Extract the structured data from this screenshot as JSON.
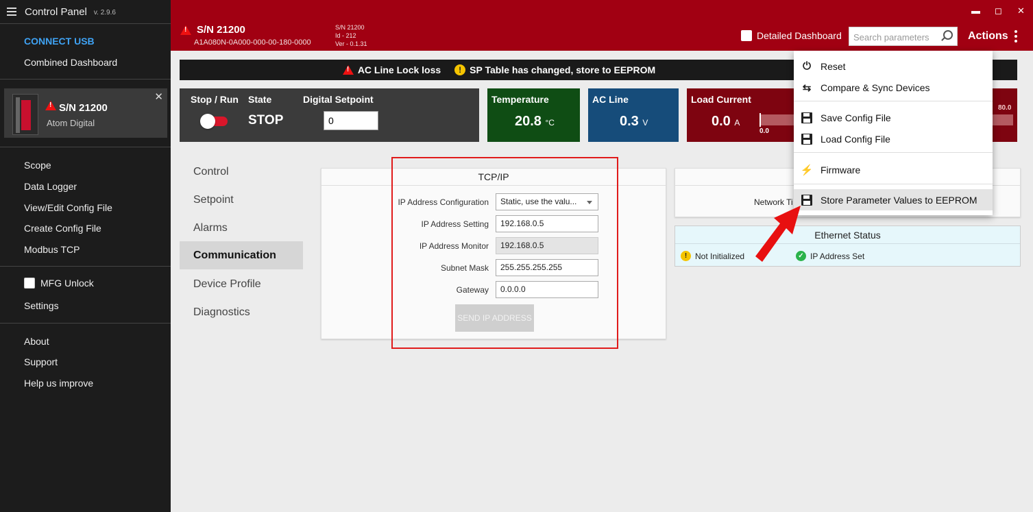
{
  "app": {
    "title": "Control Panel",
    "version": "v. 2.9.6"
  },
  "sidebar": {
    "connect_usb": "CONNECT USB",
    "combined_dashboard": "Combined Dashboard",
    "device": {
      "sn": "S/N 21200",
      "name": "Atom Digital",
      "close": "✕"
    },
    "tools": [
      "Scope",
      "Data Logger",
      "View/Edit Config File",
      "Create Config File",
      "Modbus TCP"
    ],
    "mfg_unlock": "MFG Unlock",
    "settings": "Settings",
    "about": "About",
    "support": "Support",
    "help": "Help us improve"
  },
  "header": {
    "sn": "S/N 21200",
    "model": "A1A080N-0A000-000-00-180-0000",
    "info": [
      "S/N 21200",
      "Id - 212",
      "Ver - 0.1.31"
    ],
    "detailed_dashboard": "Detailed Dashboard",
    "search_placeholder": "Search parameters",
    "actions": "Actions",
    "window": {
      "minimize": "▬",
      "maximize": "◻",
      "close": "✕"
    }
  },
  "alerts": {
    "alert1": "AC Line Lock loss",
    "alert2": "SP Table has changed, store to EEPROM"
  },
  "control": {
    "stop_run": "Stop / Run",
    "state_label": "State",
    "state_value": "STOP",
    "setpoint_label": "Digital Setpoint",
    "setpoint_value": "0"
  },
  "tiles": {
    "temperature": {
      "title": "Temperature",
      "value": "20.8",
      "unit": "°C",
      "color": "#0f4d14"
    },
    "ac_line": {
      "title": "AC Line",
      "value": "0.3",
      "unit": "V",
      "color": "#164c7a"
    },
    "load_current": {
      "title": "Load Current",
      "value": "0.0",
      "unit": "A",
      "bar_min": "0.0",
      "bar_max": "80.0",
      "color": "#7e0410"
    }
  },
  "tabs": [
    "Control",
    "Setpoint",
    "Alarms",
    "Communication",
    "Device Profile",
    "Diagnostics"
  ],
  "tcpip": {
    "title": "TCP/IP",
    "rows": [
      {
        "label": "IP Address Configuration",
        "value": "Static, use the valu..."
      },
      {
        "label": "IP Address Setting",
        "value": "192.168.0.5"
      },
      {
        "label": "IP Address Monitor",
        "value": "192.168.0.5"
      },
      {
        "label": "Subnet Mask",
        "value": "255.255.255.255"
      },
      {
        "label": "Gateway",
        "value": "0.0.0.0"
      }
    ],
    "send_button": "SEND IP ADDRESS"
  },
  "network": {
    "partial_label": "Network Ti"
  },
  "ethernet": {
    "title": "Ethernet Status",
    "status1": "Not Initialized",
    "status2": "IP Address Set"
  },
  "menu": {
    "reset": "Reset",
    "compare_sync": "Compare & Sync Devices",
    "save_config": "Save Config File",
    "load_config": "Load Config File",
    "firmware": "Firmware",
    "store_eeprom": "Store Parameter Values to EEPROM"
  }
}
